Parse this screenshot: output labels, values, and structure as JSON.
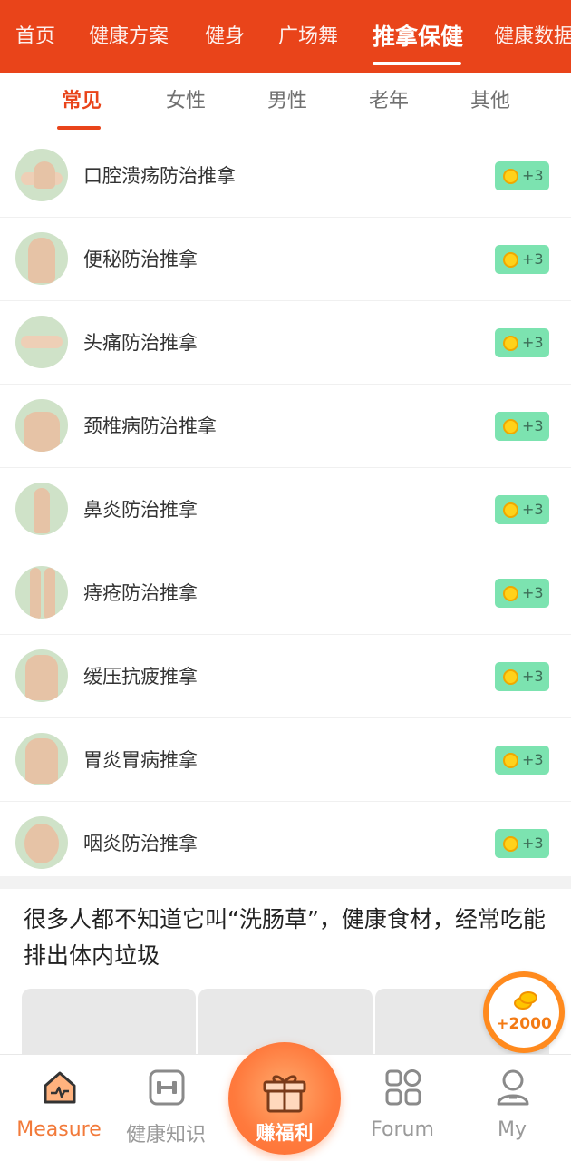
{
  "top_nav": {
    "tabs": [
      "首页",
      "健康方案",
      "健身",
      "广场舞",
      "推拿保健",
      "健康数据"
    ],
    "active_index": 4
  },
  "sub_tabs": {
    "tabs": [
      "常见",
      "女性",
      "男性",
      "老年",
      "其他"
    ],
    "active_index": 0
  },
  "list": [
    {
      "title": "口腔溃疡防治推拿",
      "reward": "+3"
    },
    {
      "title": "便秘防治推拿",
      "reward": "+3"
    },
    {
      "title": "头痛防治推拿",
      "reward": "+3"
    },
    {
      "title": "颈椎病防治推拿",
      "reward": "+3"
    },
    {
      "title": "鼻炎防治推拿",
      "reward": "+3"
    },
    {
      "title": "痔疮防治推拿",
      "reward": "+3"
    },
    {
      "title": "缓压抗疲推拿",
      "reward": "+3"
    },
    {
      "title": "胃炎胃病推拿",
      "reward": "+3"
    },
    {
      "title": "咽炎防治推拿",
      "reward": "+3"
    }
  ],
  "article": {
    "title": "很多人都不知道它叫“洗肠草”，健康食材，经常吃能排出体内垃圾"
  },
  "bonus": {
    "label": "+2000"
  },
  "bottom_nav": {
    "items": [
      {
        "label": "Measure",
        "icon": "house-heartbeat-icon"
      },
      {
        "label": "健康知识",
        "icon": "dumbbell-icon"
      },
      {
        "label": "赚福利",
        "icon": "gift-icon"
      },
      {
        "label": "Forum",
        "icon": "grid-apps-icon"
      },
      {
        "label": "My",
        "icon": "user-icon"
      }
    ],
    "active_index": 0
  },
  "colors": {
    "accent": "#e9441a",
    "badge": "#7ce3b0",
    "active_nav": "#f27a3a"
  }
}
